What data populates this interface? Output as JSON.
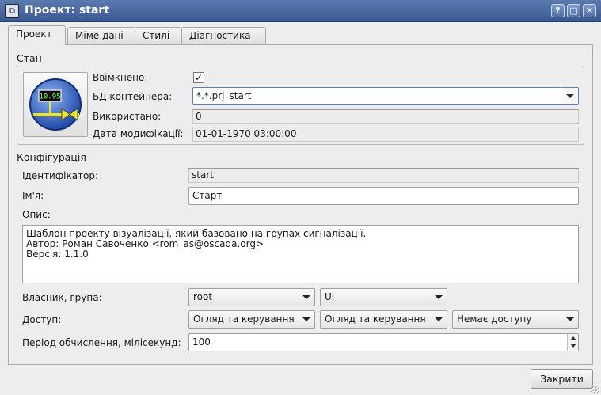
{
  "window": {
    "title": "Проект: start",
    "controls": {
      "help": "?",
      "maximize": "□",
      "close": "✕"
    }
  },
  "tabs": [
    {
      "label": "Проект",
      "active": true
    },
    {
      "label": "Міме дані",
      "active": false
    },
    {
      "label": "Стилі",
      "active": false
    },
    {
      "label": "Діагностика",
      "active": false
    }
  ],
  "state_group": {
    "title": "Стан",
    "icon": {
      "name": "project-visualization-icon",
      "display_value": "10.95"
    },
    "enabled_label": "Ввімкнено:",
    "enabled_checked": true,
    "enabled_mark": "✓",
    "db_label": "БД контейнера:",
    "db_value": "*.*.prj_start",
    "used_label": "Використано:",
    "used_value": "0",
    "modified_label": "Дата модифікації:",
    "modified_value": "01-01-1970 03:00:00"
  },
  "config_group": {
    "title": "Конфігурація",
    "id_label": "Ідентифікатор:",
    "id_value": "start",
    "name_label": "Ім'я:",
    "name_value": "Старт",
    "descr_label": "Опис:",
    "descr_lines": [
      "Шаблон проекту візуалізації, який базовано на групах сигналізації.",
      "Автор: Роман Савоченко <rom_as@oscada.org>",
      "Версія: 1.1.0"
    ],
    "owner_label": "Власник, група:",
    "owner_value": "root",
    "group_value": "UI",
    "access_label": "Доступ:",
    "access_owner": "Огляд та керування",
    "access_group": "Огляд та керування",
    "access_other": "Немає доступу",
    "period_label": "Період обчислення, мілісекунд:",
    "period_value": "100"
  },
  "footer": {
    "close_label": "Закрити"
  },
  "colors": {
    "titlebar": "#3b5a92",
    "accent": "#5b7fb8",
    "background": "#ededed"
  }
}
